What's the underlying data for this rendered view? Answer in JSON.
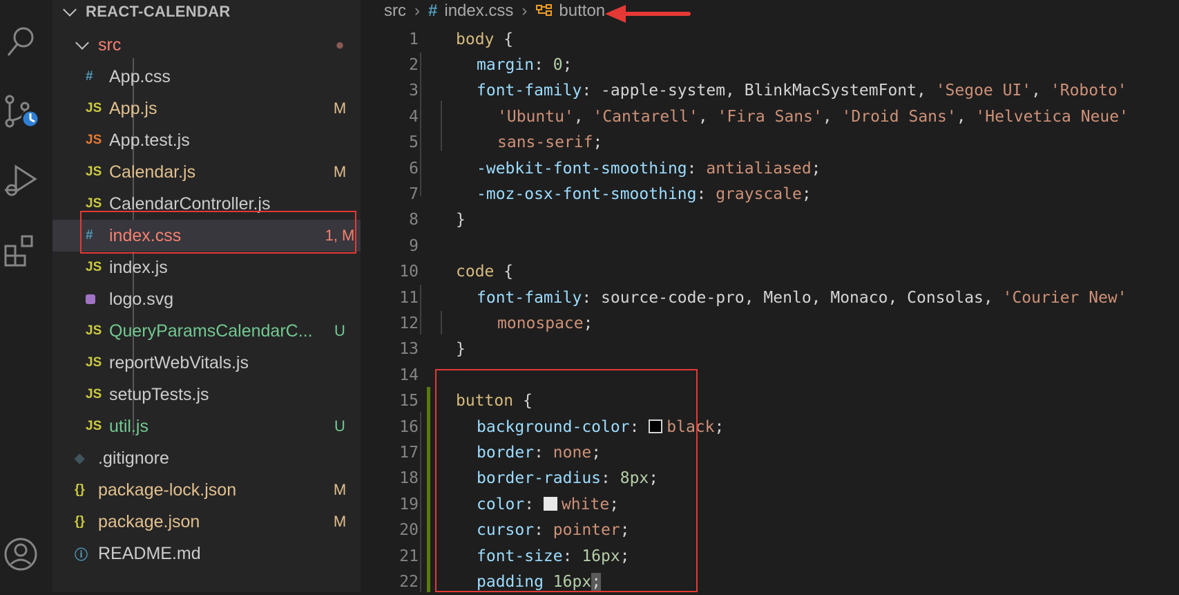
{
  "explorer": {
    "title": "REACT-CALENDAR",
    "folder": "src",
    "folder_status": "●",
    "files": [
      {
        "icon": "#",
        "name": "App.css",
        "badge": ""
      },
      {
        "icon": "JS",
        "name": "App.js",
        "badge": "M"
      },
      {
        "icon": "JS",
        "name": "App.test.js",
        "badge": ""
      },
      {
        "icon": "JS",
        "name": "Calendar.js",
        "badge": "M"
      },
      {
        "icon": "JS",
        "name": "CalendarController.js",
        "badge": ""
      },
      {
        "icon": "#",
        "name": "index.css",
        "badge": "1, M"
      },
      {
        "icon": "JS",
        "name": "index.js",
        "badge": ""
      },
      {
        "icon": "",
        "name": "logo.svg",
        "badge": ""
      },
      {
        "icon": "JS",
        "name": "QueryParamsCalendarC...",
        "badge": "U"
      },
      {
        "icon": "JS",
        "name": "reportWebVitals.js",
        "badge": ""
      },
      {
        "icon": "JS",
        "name": "setupTests.js",
        "badge": ""
      },
      {
        "icon": "JS",
        "name": "util.js",
        "badge": "U"
      }
    ],
    "root_files": [
      {
        "icon": "◆",
        "name": ".gitignore",
        "badge": ""
      },
      {
        "icon": "{}",
        "name": "package-lock.json",
        "badge": "M"
      },
      {
        "icon": "{}",
        "name": "package.json",
        "badge": "M"
      },
      {
        "icon": "ⓘ",
        "name": "README.md",
        "badge": ""
      }
    ]
  },
  "breadcrumb": {
    "folder": "src",
    "file_icon": "#",
    "file": "index.css",
    "symbol": "button"
  },
  "code_lines": [
    {
      "n": "1"
    },
    {
      "n": "2"
    },
    {
      "n": "3"
    },
    {
      "n": "4"
    },
    {
      "n": "5"
    },
    {
      "n": "6"
    },
    {
      "n": "7"
    },
    {
      "n": "8"
    },
    {
      "n": "9"
    },
    {
      "n": "10"
    },
    {
      "n": "11"
    },
    {
      "n": "12"
    },
    {
      "n": "13"
    },
    {
      "n": "14"
    },
    {
      "n": "15"
    },
    {
      "n": "16"
    },
    {
      "n": "17"
    },
    {
      "n": "18"
    },
    {
      "n": "19"
    },
    {
      "n": "20"
    },
    {
      "n": "21"
    },
    {
      "n": "22"
    }
  ],
  "code": {
    "l1": [
      "body",
      " {"
    ],
    "l2": [
      "margin",
      ": ",
      "0",
      ";"
    ],
    "l3": [
      "font-family",
      ": -apple-system, BlinkMacSystemFont, ",
      "'Segoe UI'",
      ", ",
      "'Roboto'"
    ],
    "l4": [
      "'Ubuntu'",
      ", ",
      "'Cantarell'",
      ", ",
      "'Fira Sans'",
      ", ",
      "'Droid Sans'",
      ", ",
      "'Helvetica Neue'"
    ],
    "l5": [
      "sans-serif",
      ";"
    ],
    "l6": [
      "-webkit-font-smoothing",
      ": ",
      "antialiased",
      ";"
    ],
    "l7": [
      "-moz-osx-font-smoothing",
      ": ",
      "grayscale",
      ";"
    ],
    "l8": [
      "}"
    ],
    "l10": [
      "code",
      " {"
    ],
    "l11": [
      "font-family",
      ": source-code-pro, Menlo, Monaco, Consolas, ",
      "'Courier New'"
    ],
    "l12": [
      "monospace",
      ";"
    ],
    "l13": [
      "}"
    ],
    "l15": [
      "button",
      " {"
    ],
    "l16": [
      "background-color",
      ": ",
      "black",
      ";"
    ],
    "l17": [
      "border",
      ": ",
      "none",
      ";"
    ],
    "l18": [
      "border-radius",
      ": ",
      "8px",
      ";"
    ],
    "l19": [
      "color",
      ": ",
      "white",
      ";"
    ],
    "l20": [
      "cursor",
      ": ",
      "pointer",
      ";"
    ],
    "l21": [
      "font-size",
      ": ",
      "16px",
      ";"
    ],
    "l22": [
      "padding",
      " ",
      "16px",
      ";"
    ]
  },
  "colors": {
    "accent_red": "#e53935",
    "swatch_black": "#000000",
    "swatch_white": "#e8e8e8"
  }
}
